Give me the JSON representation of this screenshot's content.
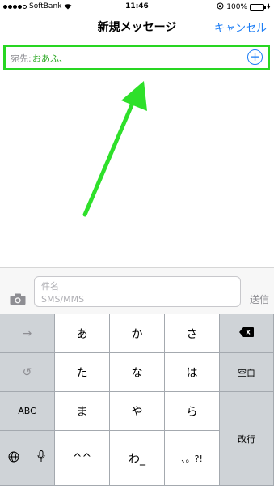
{
  "status_bar": {
    "carrier": "SoftBank",
    "time": "11:46",
    "battery": "100%"
  },
  "nav": {
    "title": "新規メッセージ",
    "cancel_label": "キャンセル"
  },
  "recipient": {
    "label": "宛先:",
    "value": "おあふ、"
  },
  "composer": {
    "subject_placeholder": "件名",
    "message_placeholder": "SMS/MMS",
    "send_label": "送信"
  },
  "keyboard": {
    "row1": [
      "→",
      "あ",
      "か",
      "さ"
    ],
    "row2": [
      "↺",
      "た",
      "な",
      "は"
    ],
    "row3": [
      "ABC",
      "ま",
      "や",
      "ら"
    ],
    "row4": [
      "^^",
      "わ_",
      "、。?!"
    ],
    "space_label": "空白",
    "return_label": "改行",
    "delete_icon": "delete-icon",
    "globe_icon": "globe-icon",
    "mic_icon": "mic-icon"
  },
  "colors": {
    "accent": "#1a7cf5",
    "highlight": "#28d622",
    "keyboard_bg": "#c9cdd2"
  }
}
